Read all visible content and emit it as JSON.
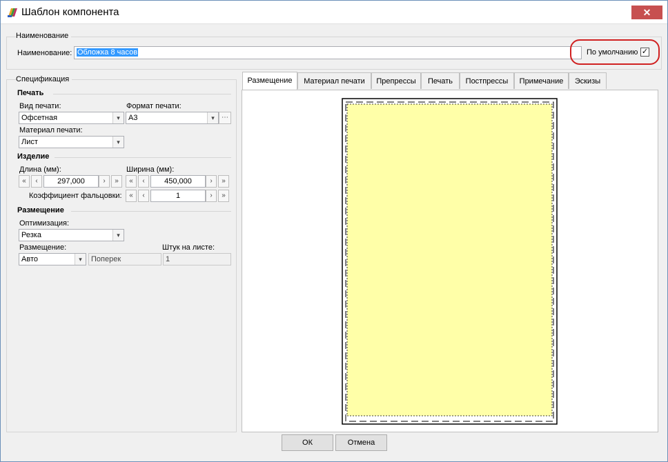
{
  "window": {
    "title": "Шаблон компонента",
    "close_glyph": "✕",
    "app_icon": "palette-icon"
  },
  "name_section": {
    "group_title": "Наименование",
    "field_label": "Наименование:",
    "field_value": "Обложка 8 часов",
    "default_label": "По умолчанию",
    "default_checked": true
  },
  "spec": {
    "group_title": "Спецификация",
    "print": {
      "header": "Печать",
      "print_type_label": "Вид печати:",
      "print_type_value": "Офсетная",
      "print_format_label": "Формат печати:",
      "print_format_value": "А3",
      "material_label": "Материал печати:",
      "material_value": "Лист"
    },
    "product": {
      "header": "Изделие",
      "length_label": "Длина (мм):",
      "length_value": "297,000",
      "width_label": "Ширина (мм):",
      "width_value": "450,000",
      "fold_label": "Коэффициент фальцовки:",
      "fold_value": "1"
    },
    "placement": {
      "header": "Размещение",
      "optimization_label": "Оптимизация:",
      "optimization_value": "Резка",
      "placement_label": "Размещение:",
      "placement_value": "Авто",
      "orientation_value": "Поперек",
      "per_sheet_label": "Штук на листе:",
      "per_sheet_value": "1"
    }
  },
  "tabs": [
    {
      "label": "Размещение",
      "active": true
    },
    {
      "label": "Материал печати",
      "active": false
    },
    {
      "label": "Препрессы",
      "active": false
    },
    {
      "label": "Печать",
      "active": false
    },
    {
      "label": "Постпрессы",
      "active": false
    },
    {
      "label": "Примечание",
      "active": false
    },
    {
      "label": "Эскизы",
      "active": false
    }
  ],
  "preview": {
    "sheet_color": "#ffffa8"
  },
  "buttons": {
    "ok": "ОК",
    "cancel": "Отмена"
  },
  "glyphs": {
    "first": "«",
    "prev": "‹",
    "next": "›",
    "last": "»",
    "dropdown": "▾",
    "ellipsis": "⋯",
    "check": "✓"
  }
}
